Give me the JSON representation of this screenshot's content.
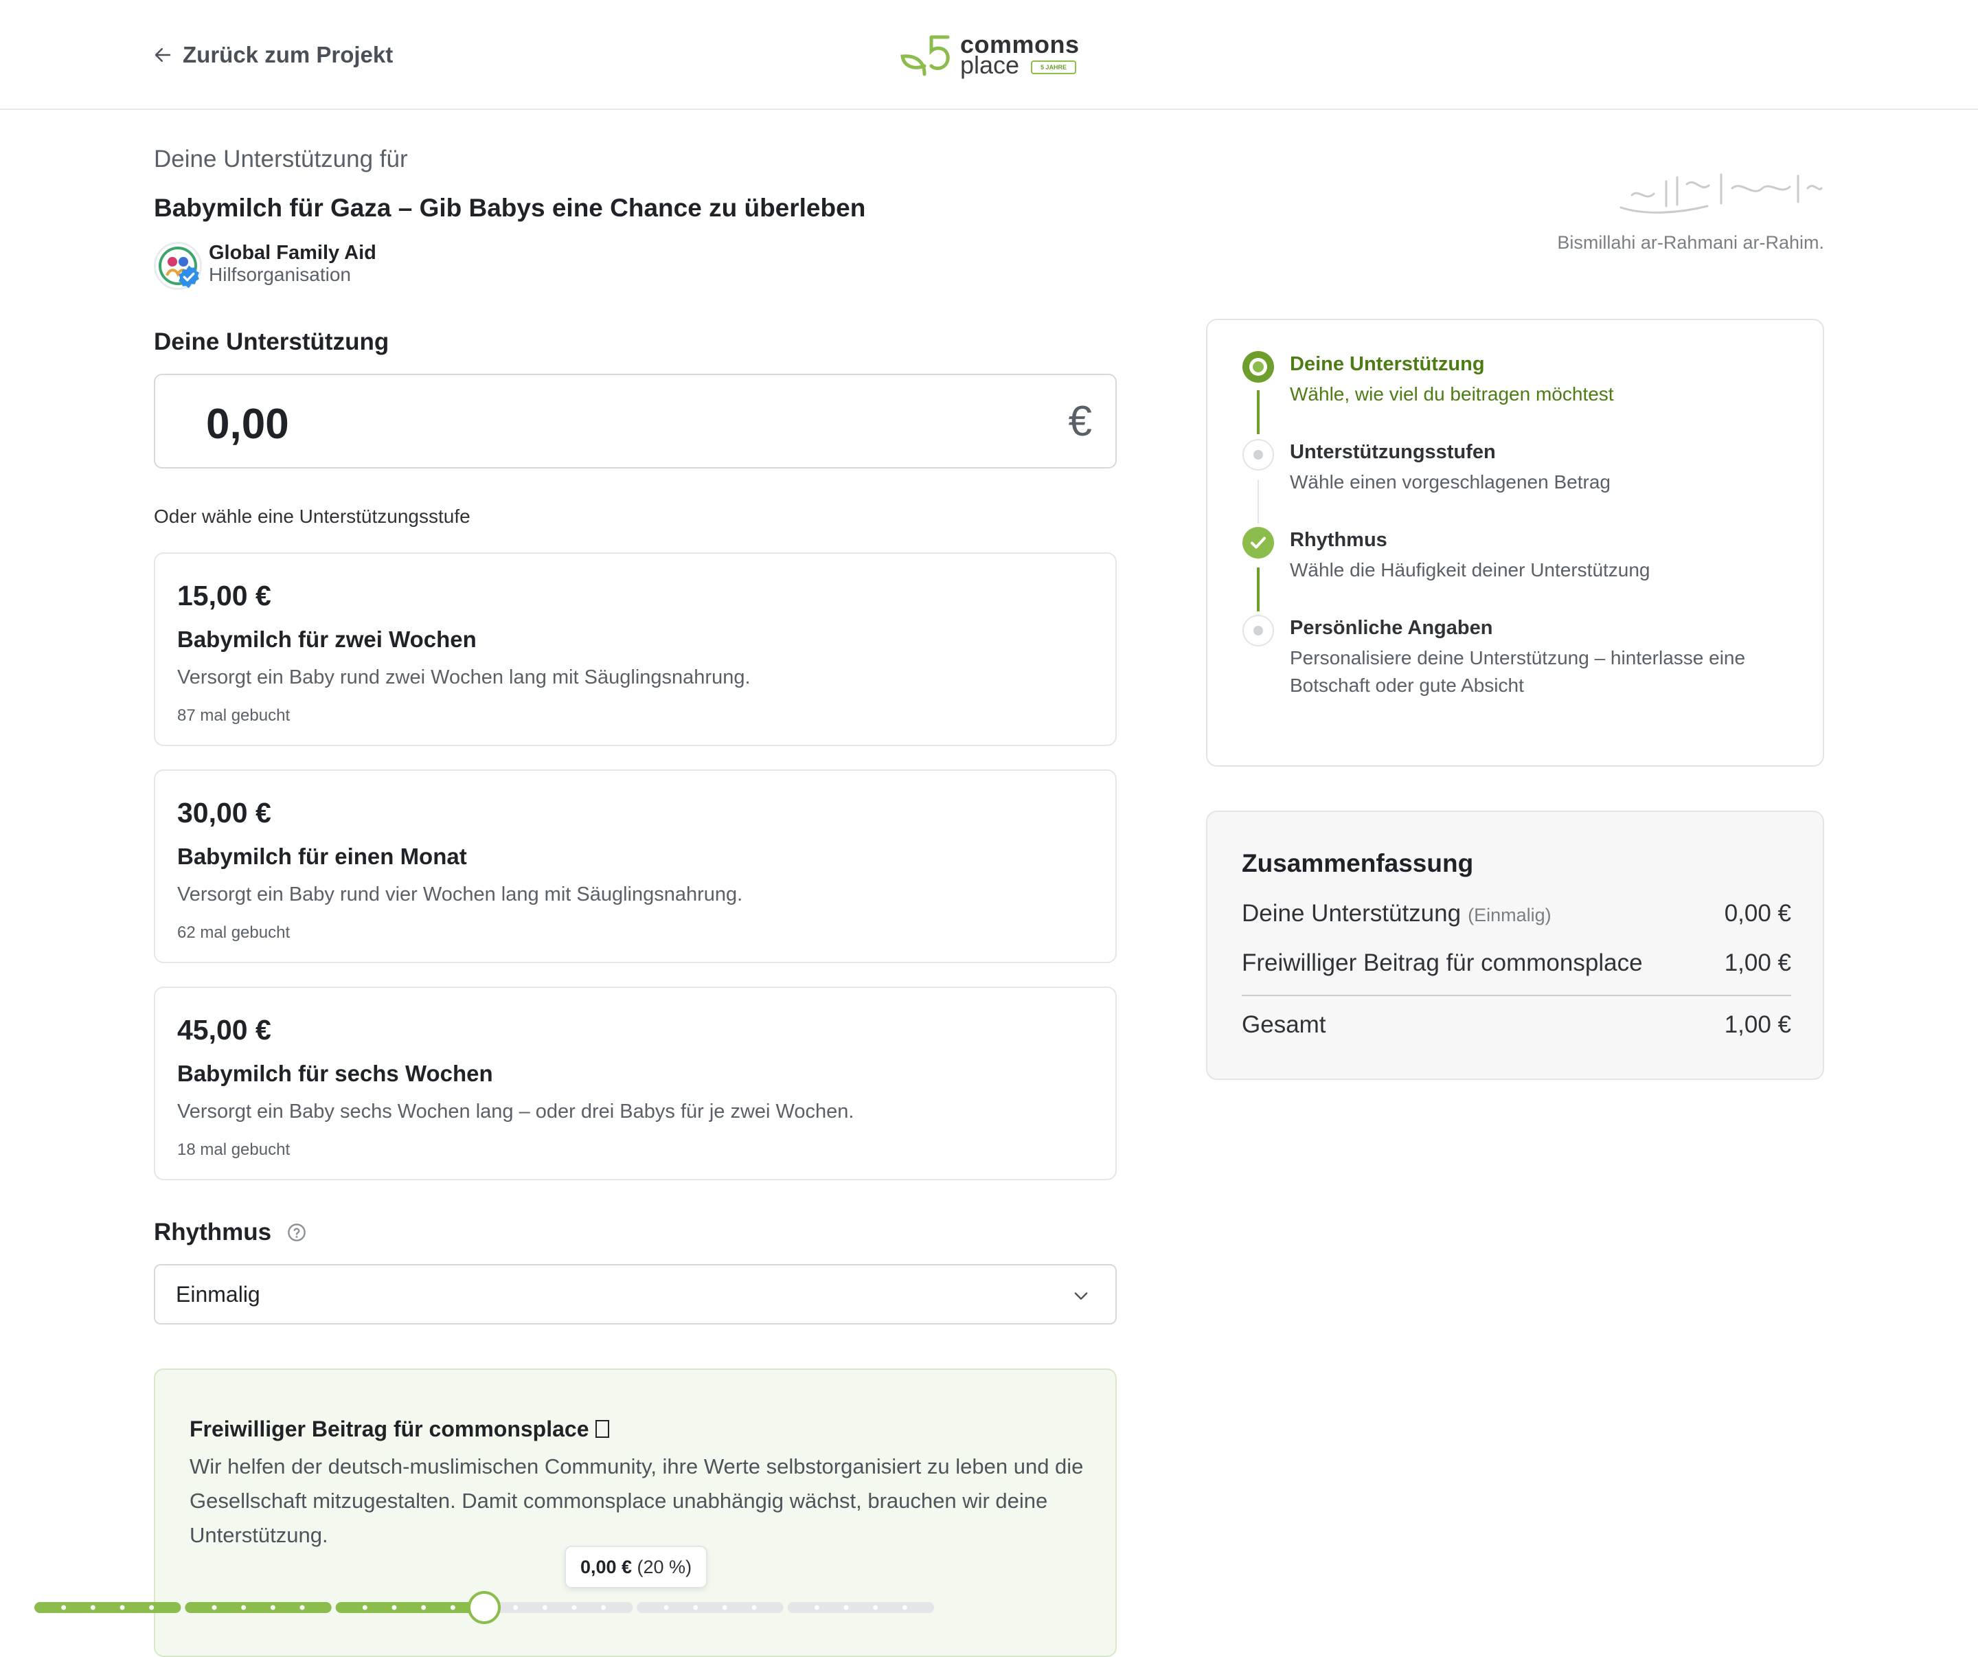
{
  "header": {
    "back_label": "Zurück zum Projekt",
    "logo": {
      "line1": "commons",
      "line2": "place",
      "badge": "5 JAHRE"
    }
  },
  "project": {
    "intro": "Deine Unterstützung für",
    "title": "Babymilch für Gaza – Gib Babys eine Chance zu überleben",
    "org_name": "Global Family Aid",
    "org_type": "Hilfsorganisation"
  },
  "blessing": {
    "transliteration": "Bismillahi ar-Rahmani ar-Rahim."
  },
  "support": {
    "heading": "Deine Unterstützung",
    "amount": "0,00",
    "currency": "€",
    "tiers_label": "Oder wähle eine Unterstützungsstufe",
    "tiers": [
      {
        "price": "15,00 €",
        "name": "Babymilch für zwei Wochen",
        "desc": "Versorgt ein Baby rund zwei Wochen lang mit Säuglingsnahrung.",
        "count": "87 mal gebucht"
      },
      {
        "price": "30,00 €",
        "name": "Babymilch für einen Monat",
        "desc": "Versorgt ein Baby rund vier Wochen lang mit Säuglingsnahrung.",
        "count": "62 mal gebucht"
      },
      {
        "price": "45,00 €",
        "name": "Babymilch für sechs Wochen",
        "desc": "Versorgt ein Baby sechs Wochen lang – oder drei Babys für je zwei Wochen.",
        "count": "18 mal gebucht"
      }
    ]
  },
  "rhythm": {
    "heading": "Rhythmus",
    "selected": "Einmalig"
  },
  "tip": {
    "title": "Freiwilliger Beitrag für commonsplace",
    "body": "Wir helfen der deutsch-muslimischen Community, ihre Werte selbstorganisiert zu leben und die Gesellschaft mitzugestalten. Damit commonsplace unabhängig wächst, brauchen wir deine Unterstützung.",
    "bubble_amount": "0,00 €",
    "bubble_percent": "(20 %)",
    "slider_fraction": 0.5
  },
  "steps": [
    {
      "title": "Deine Unterstützung",
      "sub": "Wähle, wie viel du beitragen möchtest",
      "state": "active"
    },
    {
      "title": "Unterstützungsstufen",
      "sub": "Wähle einen vorgeschlagenen Betrag",
      "state": "pending"
    },
    {
      "title": "Rhythmus",
      "sub": "Wähle die Häufigkeit deiner Unterstützung",
      "state": "done"
    },
    {
      "title": "Persönliche Angaben",
      "sub": "Personalisiere deine Unterstützung – hinterlasse eine Botschaft oder gute Absicht",
      "state": "pending"
    }
  ],
  "summary": {
    "heading": "Zusammenfassung",
    "support_label": "Deine Unterstützung",
    "support_note": "(Einmalig)",
    "support_value": "0,00 €",
    "fee_label": "Freiwilliger Beitrag für commonsplace",
    "fee_value": "1,00 €",
    "total_label": "Gesamt",
    "total_value": "1,00 €"
  },
  "colors": {
    "accent": "#8cbd4c",
    "accent_dark": "#4d7c14",
    "tip_bg": "#f3f9ee"
  }
}
